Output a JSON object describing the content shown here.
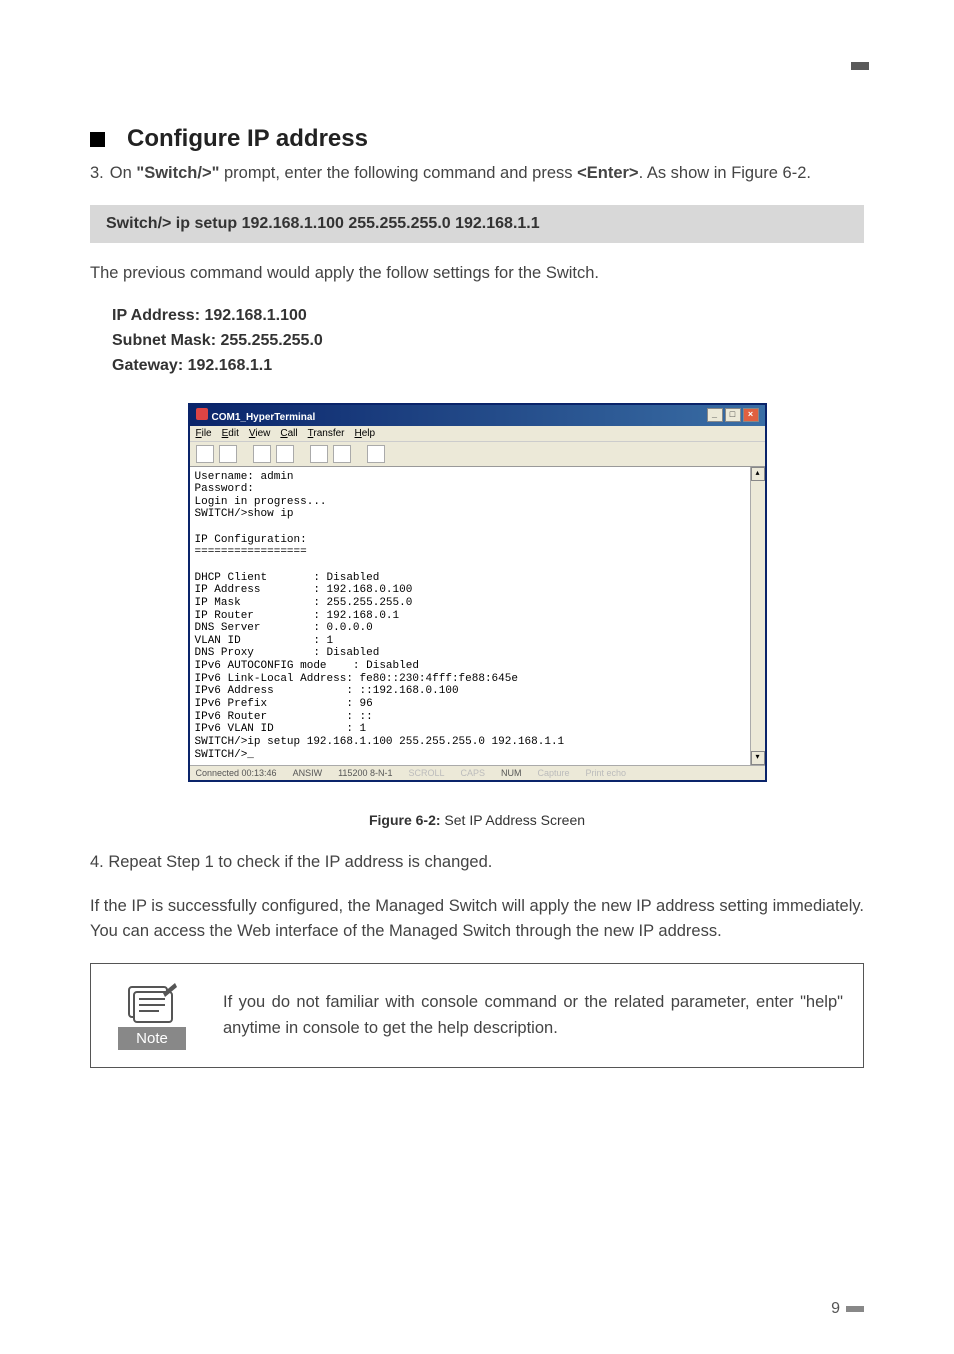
{
  "heading": "Configure IP address",
  "step3": {
    "num": "3.",
    "pre": "On ",
    "prompt": "\"Switch/>\"",
    "mid": " prompt, enter the following command and press ",
    "key": "<Enter>",
    "post": ". As show in Figure 6-2."
  },
  "command_line": "Switch/> ip setup 192.168.1.100 255.255.255.0 192.168.1.1",
  "prev_cmd_text": "The previous command would apply the follow settings for the Switch.",
  "settings": {
    "ip": "IP Address: 192.168.1.100",
    "mask": "Subnet Mask: 255.255.255.0",
    "gw": "Gateway: 192.168.1.1"
  },
  "hyperterm": {
    "title": "COM1_HyperTerminal",
    "menus": [
      "File",
      "Edit",
      "View",
      "Call",
      "Transfer",
      "Help"
    ],
    "terminal": "Username: admin\nPassword:\nLogin in progress...\nSWITCH/>show ip\n\nIP Configuration:\n=================\n\nDHCP Client       : Disabled\nIP Address        : 192.168.0.100\nIP Mask           : 255.255.255.0\nIP Router         : 192.168.0.1\nDNS Server        : 0.0.0.0\nVLAN ID           : 1\nDNS Proxy         : Disabled\nIPv6 AUTOCONFIG mode    : Disabled\nIPv6 Link-Local Address: fe80::230:4fff:fe88:645e\nIPv6 Address           : ::192.168.0.100\nIPv6 Prefix            : 96\nIPv6 Router            : ::\nIPv6 VLAN ID           : 1\nSWITCH/>ip setup 192.168.1.100 255.255.255.0 192.168.1.1\nSWITCH/>_",
    "status": {
      "connected": "Connected 00:13:46",
      "detect": "ANSIW",
      "baud": "115200 8-N-1",
      "scroll": "SCROLL",
      "caps": "CAPS",
      "num": "NUM",
      "capture": "Capture",
      "echo": "Print echo"
    }
  },
  "figure_caption_bold": "Figure 6-2:",
  "figure_caption_rest": "  Set IP Address Screen",
  "step4": "4. Repeat Step 1 to check if the IP address is changed.",
  "para_success": "If the IP is successfully configured, the Managed Switch will apply the new IP address setting immediately. You can access the Web interface of the Managed Switch through the new IP address.",
  "note": {
    "label": "Note",
    "text": "If you do not familiar with console command or the related parameter, enter \"help\" anytime in console to get the help description."
  },
  "page_number": "9"
}
